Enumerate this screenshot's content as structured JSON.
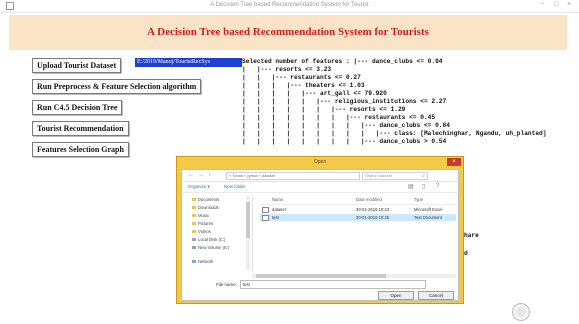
{
  "window": {
    "title": "A Decision Tree based Recommendation System for Tourist",
    "minimize": "−",
    "maximize": "□",
    "close": "×"
  },
  "header": {
    "title": "A Decision Tree based Recommendation System for Tourists"
  },
  "side_buttons": [
    "Upload Tourist Dataset",
    "Run Preprocess & Feature Selection algorithm",
    "Run C4.5 Decision Tree",
    "Tourist Recommendation",
    "Features Selection Graph"
  ],
  "dataset_path": "E:/2019/Manoj/TouristRecSys",
  "tree_output": [
    "Selected number of features : |--- dance_clubs <= 0.94",
    "|   |--- resorts <= 3.23",
    "|   |   |--- restaurants <= 0.27",
    "|   |   |   |--- theaters <= 1.03",
    "|   |   |   |   |--- art_gall <= 79.920",
    "|   |   |   |   |   |--- religious_institutions <= 2.27",
    "|   |   |   |   |   |   |--- resorts <= 1.29",
    "|   |   |   |   |   |   |   |--- restaurants <= 0.45",
    "|   |   |   |   |   |   |   |   |--- dance_clubs <= 0.84",
    "|   |   |   |   |   |   |   |   |   |--- class: [Malechinghar, Ngandu, uh_planted]",
    "|   |   |   |   |   |   |   |   |--- dance_clubs > 0.54"
  ],
  "tree_right_fragments": [
    "hare",
    "d"
  ],
  "dialog": {
    "title": "Open",
    "close": "×",
    "address": "« Touris › python › dataset",
    "search_placeholder": "Search dataset",
    "organize": "Organize ▾",
    "new_folder": "New folder",
    "nav_items": [
      "Documents",
      "Downloads",
      "Music",
      "Pictures",
      "Videos",
      "Local Disk (C:)",
      "New Volume (E:)",
      "Network"
    ],
    "columns": [
      "Name",
      "Date modified",
      "Type"
    ],
    "files": [
      {
        "name": "dataset",
        "date": "30-01-2019 10:43",
        "type": "Microsoft Excel"
      },
      {
        "name": "test",
        "date": "30-01-2019 10:45",
        "type": "Text Document"
      }
    ],
    "filename_label": "File name:",
    "filename_value": "test",
    "open_label": "Open",
    "cancel_label": "Cancel"
  }
}
